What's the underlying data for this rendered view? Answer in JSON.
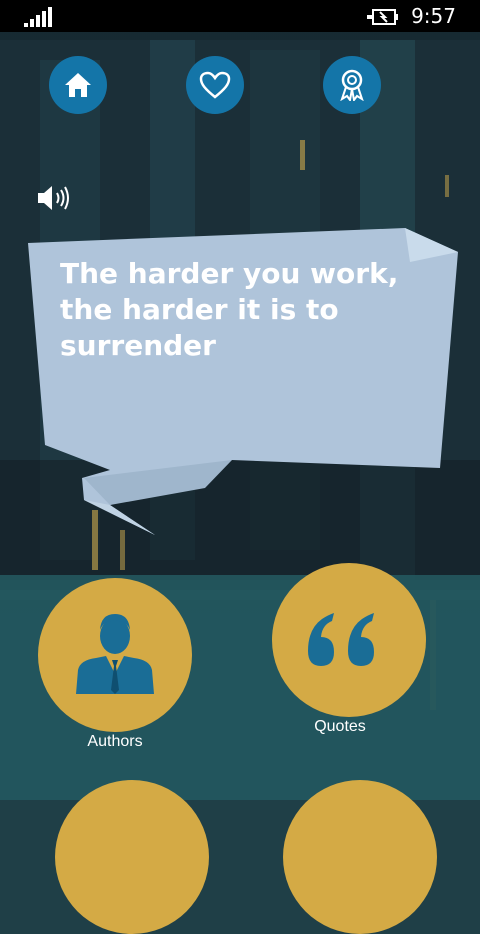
{
  "status_bar": {
    "time": "9:57",
    "signal_icon": "signal-icon",
    "battery_icon": "battery-charging-icon"
  },
  "nav": {
    "home_icon": "home-icon",
    "favorites_icon": "heart-icon",
    "awards_icon": "ribbon-icon",
    "button_color": "#1475a8"
  },
  "speak_icon": "speaker-icon",
  "quote": {
    "text": "The harder you work, the harder it is to surrender"
  },
  "menu": {
    "accent": "#d4aa45",
    "items": [
      {
        "label": "Authors",
        "icon": "person-icon"
      },
      {
        "label": "Quotes",
        "icon": "quote-marks-icon"
      }
    ]
  }
}
